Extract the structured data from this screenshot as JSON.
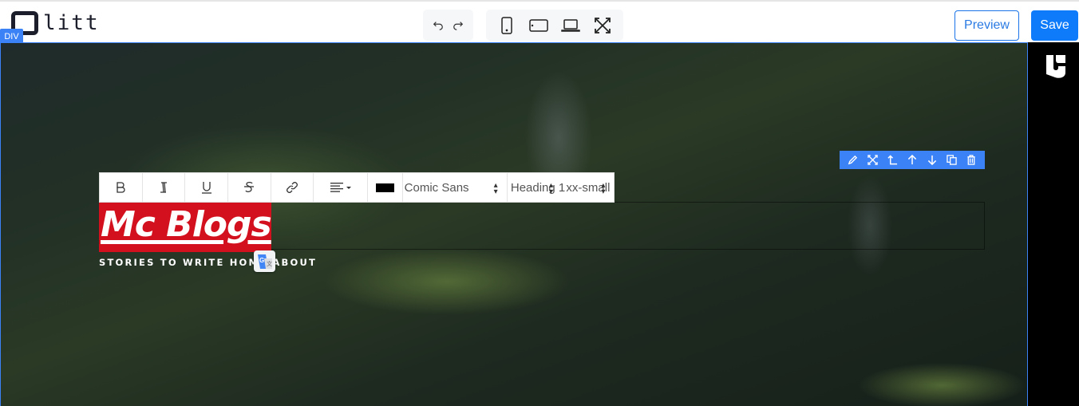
{
  "header": {
    "logo_text": "litt",
    "history": [
      {
        "name": "undo",
        "icon": "undo-icon"
      },
      {
        "name": "redo",
        "icon": "redo-icon"
      }
    ],
    "devices": [
      {
        "name": "mobile",
        "icon": "mobile-icon"
      },
      {
        "name": "tablet",
        "icon": "tablet-icon"
      },
      {
        "name": "desktop",
        "icon": "laptop-icon"
      },
      {
        "name": "fullscreen",
        "icon": "fullscreen-icon"
      }
    ],
    "preview_label": "Preview",
    "save_label": "Save"
  },
  "canvas": {
    "selected_element_badge": "DIV",
    "accent_color": "#3b82f6",
    "element_toolbar": [
      {
        "name": "edit",
        "icon": "pencil-icon"
      },
      {
        "name": "move",
        "icon": "move-arrows-icon"
      },
      {
        "name": "select-parent",
        "icon": "parent-arrow-icon"
      },
      {
        "name": "move-up",
        "icon": "arrow-up-icon"
      },
      {
        "name": "move-down",
        "icon": "arrow-down-icon"
      },
      {
        "name": "duplicate",
        "icon": "copy-icon"
      },
      {
        "name": "delete",
        "icon": "trash-icon"
      }
    ],
    "text_toolbar": {
      "buttons": [
        "bold",
        "italic",
        "underline",
        "strikethrough",
        "link",
        "align"
      ],
      "text_color": "#000000",
      "font_family": "Comic Sans",
      "format": "Heading 1",
      "font_size": "xx-small"
    },
    "site": {
      "title": "Mc Blogs",
      "title_bg_color": "#d3101e",
      "tagline": "STORIES TO WRITE HOME ABOUT"
    }
  }
}
